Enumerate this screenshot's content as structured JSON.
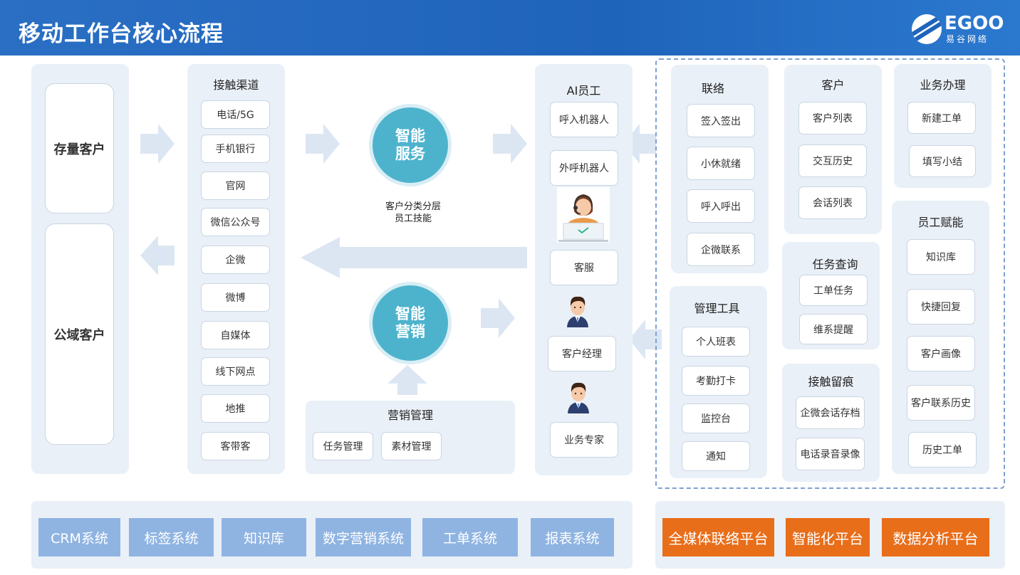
{
  "header": {
    "title": "移动工作台核心流程",
    "logo_text": "EGOO",
    "logo_sub": "易谷网络",
    "color": "#1f64bb"
  },
  "customers": [
    "存量客户",
    "公域客户"
  ],
  "channels": {
    "title": "接触渠道",
    "items": [
      "电话/5G",
      "手机银行",
      "官网",
      "微信公众号",
      "企微",
      "微博",
      "自媒体",
      "线下网点",
      "地推",
      "客带客"
    ]
  },
  "center": {
    "service": [
      "智能",
      "服务"
    ],
    "note": [
      "客户分类分层",
      "员工技能"
    ],
    "marketing": [
      "智能",
      "营销"
    ]
  },
  "marketing_mgmt": {
    "title": "营销管理",
    "items": [
      "任务管理",
      "素材管理"
    ]
  },
  "ai_staff": {
    "title": "AI员工",
    "items": [
      "呼入机器人",
      "外呼机器人",
      "客服",
      "客户经理",
      "业务专家"
    ]
  },
  "contact": {
    "title": "联络",
    "items": [
      "签入签出",
      "小休就绪",
      "呼入呼出",
      "企微联系"
    ]
  },
  "customer": {
    "title": "客户",
    "items": [
      "客户列表",
      "交互历史",
      "会话列表"
    ]
  },
  "business": {
    "title": "业务办理",
    "items": [
      "新建工单",
      "填写小结"
    ]
  },
  "task_query": {
    "title": "任务查询",
    "items": [
      "工单任务",
      "维系提醒"
    ]
  },
  "mgmt_tools": {
    "title": "管理工具",
    "items": [
      "个人班表",
      "考勤打卡",
      "监控台",
      "通知"
    ]
  },
  "trace": {
    "title": "接触留痕",
    "items": [
      "企微会话存档",
      "电话录音录像"
    ]
  },
  "empower": {
    "title": "员工赋能",
    "items": [
      "知识库",
      "快捷回复",
      "客户画像",
      "客户联系历史",
      "历史工单"
    ]
  },
  "systems": [
    "CRM系统",
    "标签系统",
    "知识库",
    "数字营销系统",
    "工单系统",
    "报表系统"
  ],
  "platforms": [
    "全媒体联络平台",
    "智能化平台",
    "数据分析平台"
  ],
  "colors": {
    "panel": "#eaf0f7",
    "arrow": "#dce6f3",
    "circle": "#4db3cd",
    "system": "#8fb4e2",
    "platform": "#e86e1a",
    "dashed_border": "#7f9fd2"
  }
}
